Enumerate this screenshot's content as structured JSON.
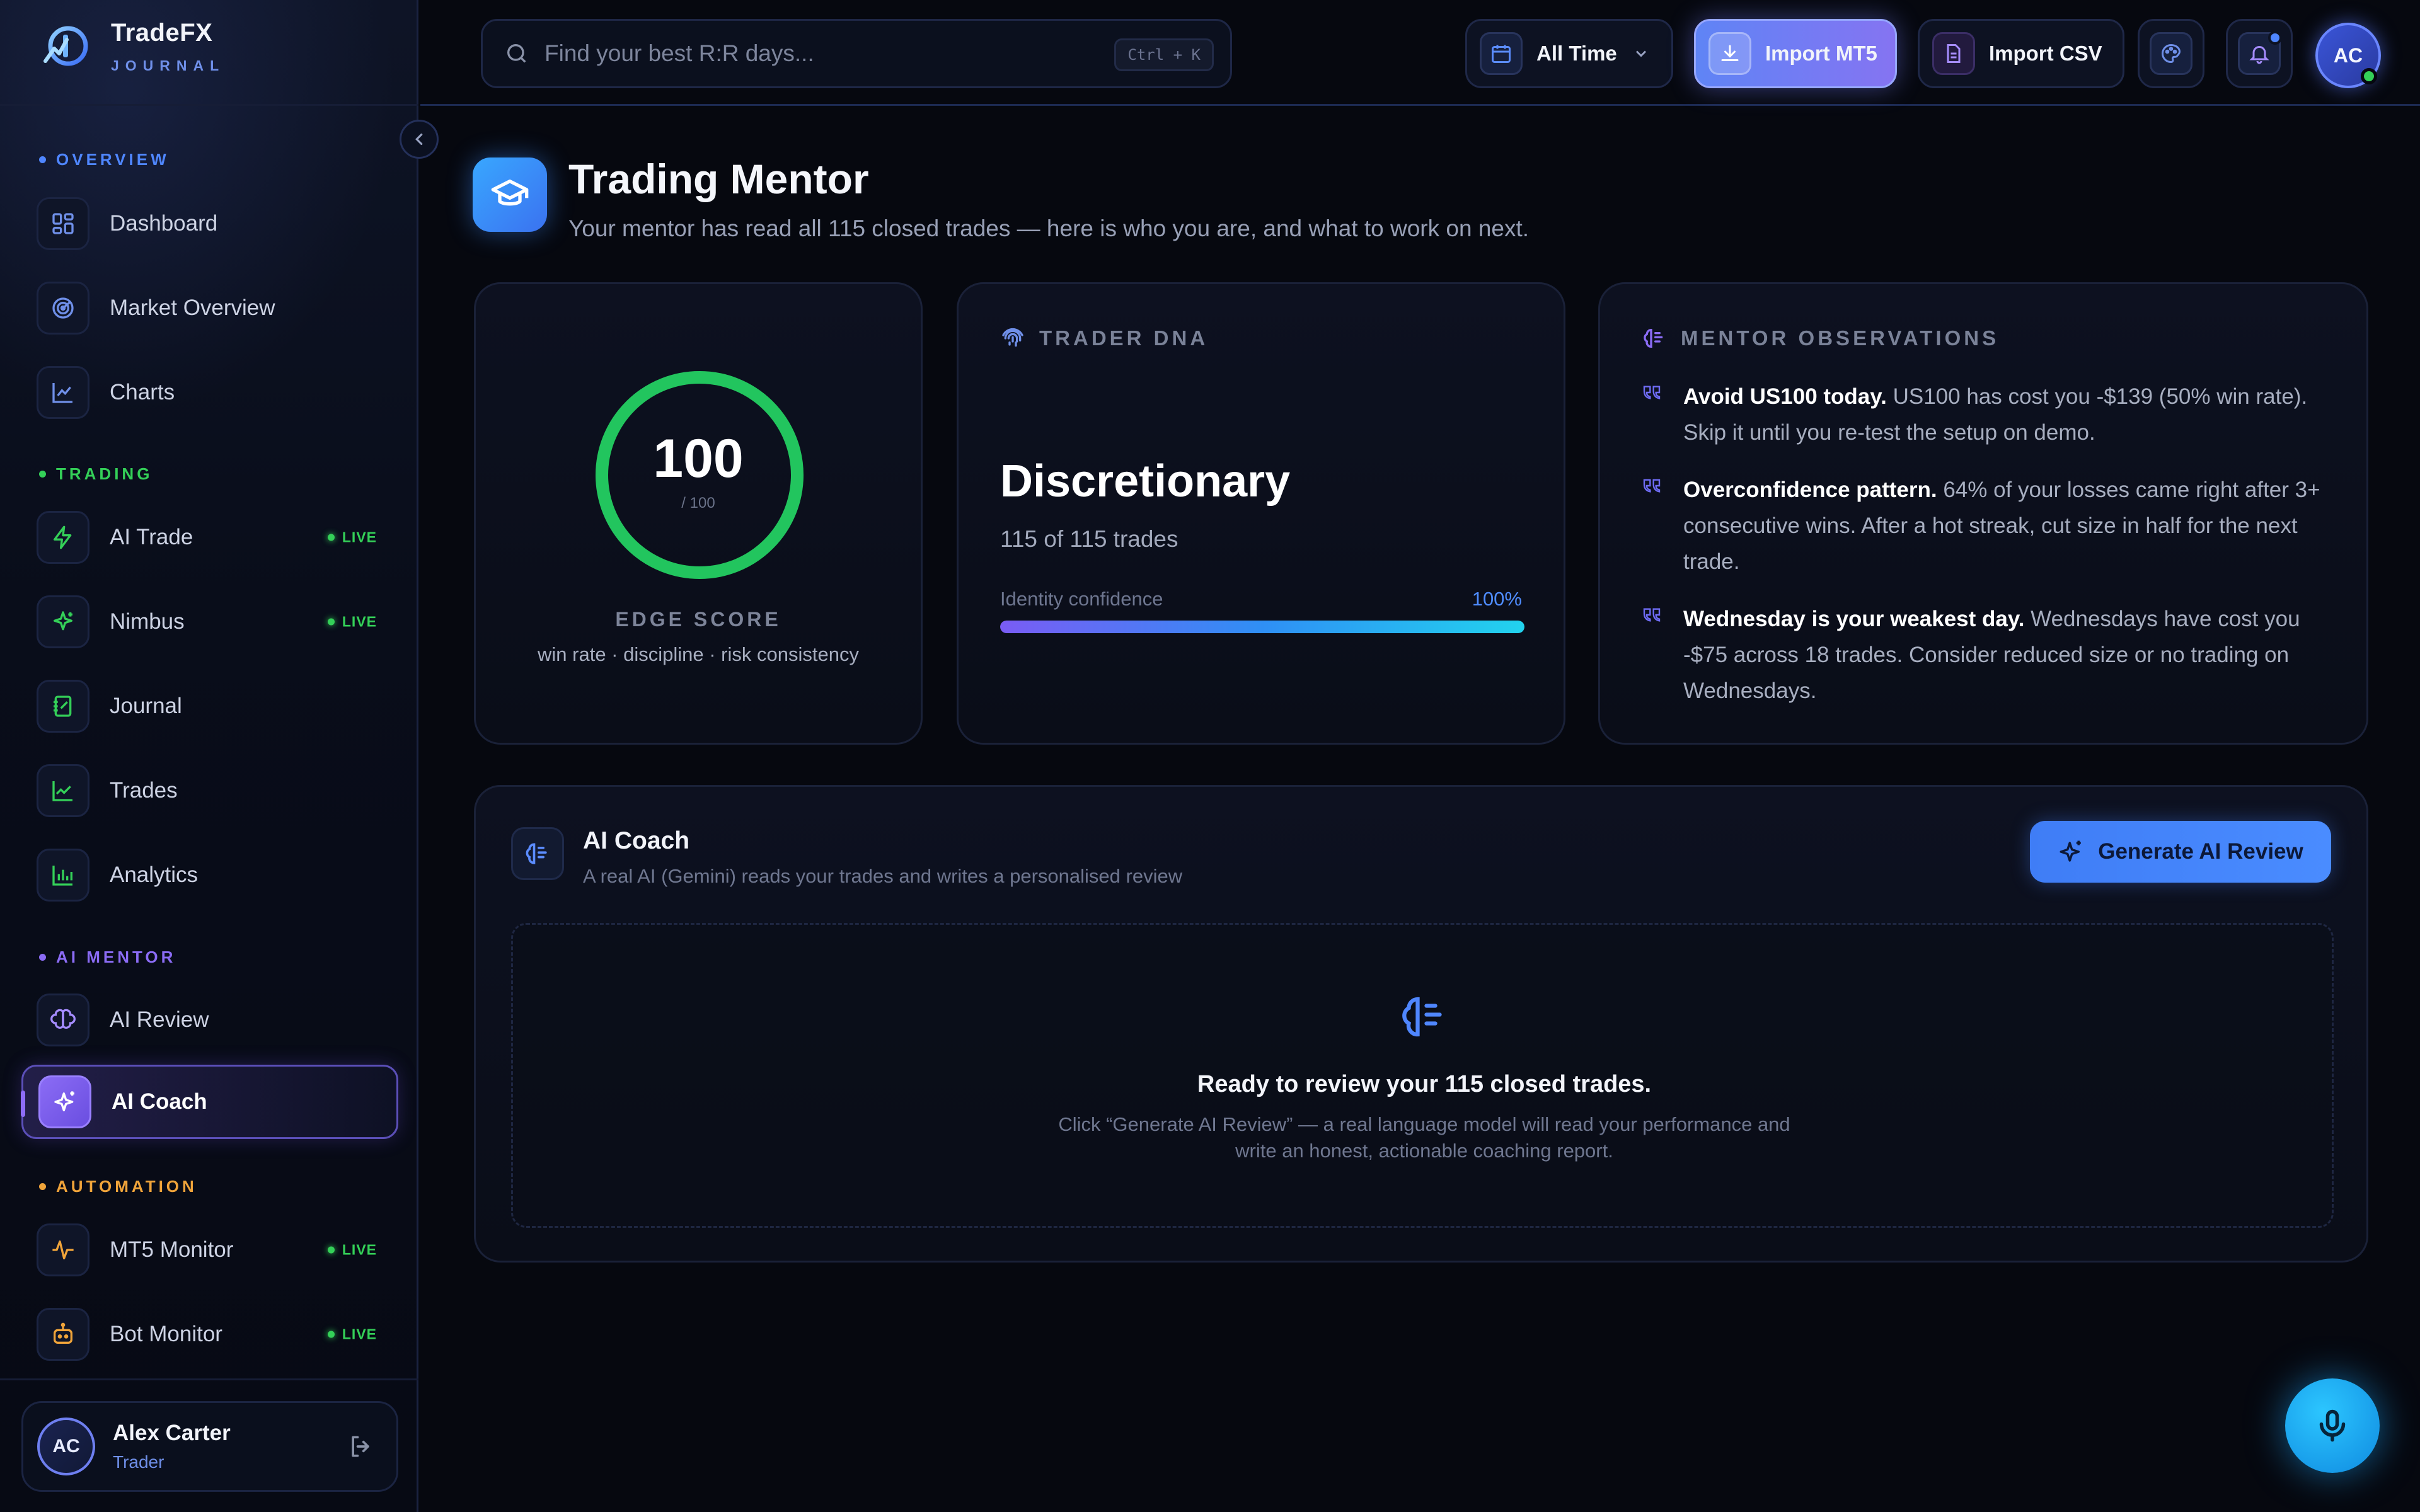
{
  "brand": {
    "name": "TradeFX",
    "tagline": "JOURNAL"
  },
  "colors": {
    "accent_blue": "#4f86ff",
    "accent_purple": "#8b6cf5",
    "live_green": "#34d058",
    "overview_dot": "#4f86ff",
    "trading_dot": "#34d058",
    "mentor_dot": "#8b6cf5",
    "automation_dot": "#f0a43a"
  },
  "sidebar": {
    "sections": [
      {
        "label": "OVERVIEW"
      },
      {
        "label": "TRADING"
      },
      {
        "label": "AI MENTOR"
      },
      {
        "label": "AUTOMATION"
      }
    ],
    "items": [
      {
        "label": "Dashboard",
        "icon": "grid-icon"
      },
      {
        "label": "Market Overview",
        "icon": "radar-icon"
      },
      {
        "label": "Charts",
        "icon": "area-chart-icon"
      },
      {
        "label": "AI Trade",
        "icon": "bolt-icon",
        "badge": "LIVE"
      },
      {
        "label": "Nimbus",
        "icon": "sparkle-icon",
        "badge": "LIVE"
      },
      {
        "label": "Journal",
        "icon": "notebook-icon"
      },
      {
        "label": "Trades",
        "icon": "line-chart-icon"
      },
      {
        "label": "Analytics",
        "icon": "bar-chart-icon"
      },
      {
        "label": "AI Review",
        "icon": "brain-icon"
      },
      {
        "label": "AI Coach",
        "icon": "sparkles-icon",
        "active": true
      },
      {
        "label": "MT5 Monitor",
        "icon": "pulse-icon",
        "badge": "LIVE"
      },
      {
        "label": "Bot Monitor",
        "icon": "bot-icon",
        "badge": "LIVE"
      }
    ],
    "user": {
      "initials": "AC",
      "name": "Alex Carter",
      "role": "Trader"
    }
  },
  "topbar": {
    "search_placeholder": "Find your best R:R days...",
    "shortcut": "Ctrl + K",
    "range_label": "All Time",
    "import_mt5": "Import MT5",
    "import_csv": "Import CSV",
    "avatar_initials": "AC"
  },
  "page": {
    "title": "Trading Mentor",
    "subtitle": "Your mentor has read all 115 closed trades — here is who you are, and what to work on next."
  },
  "edge": {
    "score": "100",
    "max": "/ 100",
    "score_fraction": 1.0,
    "label": "EDGE SCORE",
    "desc": "win rate · discipline · risk consistency"
  },
  "dna": {
    "heading": "TRADER DNA",
    "type": "Discretionary",
    "count": "115 of 115 trades",
    "confidence_label": "Identity confidence",
    "confidence_value": "100%",
    "confidence_fraction": 1.0
  },
  "observations": {
    "heading": "MENTOR OBSERVATIONS",
    "items": [
      {
        "bold": "Avoid US100 today.",
        "text": " US100 has cost you -$139 (50% win rate). Skip it until you re-test the setup on demo."
      },
      {
        "bold": "Overconfidence pattern.",
        "text": " 64% of your losses came right after 3+ consecutive wins. After a hot streak, cut size in half for the next trade."
      },
      {
        "bold": "Wednesday is your weakest day.",
        "text": " Wednesdays have cost you -$75 across 18 trades. Consider reduced size or no trading on Wednesdays."
      }
    ]
  },
  "coach": {
    "title": "AI Coach",
    "subtitle": "A real AI (Gemini) reads your trades and writes a personalised review",
    "button": "Generate AI Review",
    "empty_title": "Ready to review your 115 closed trades.",
    "empty_line1": "Click “Generate AI Review” — a real language model will read your performance and",
    "empty_line2": "write an honest, actionable coaching report."
  }
}
